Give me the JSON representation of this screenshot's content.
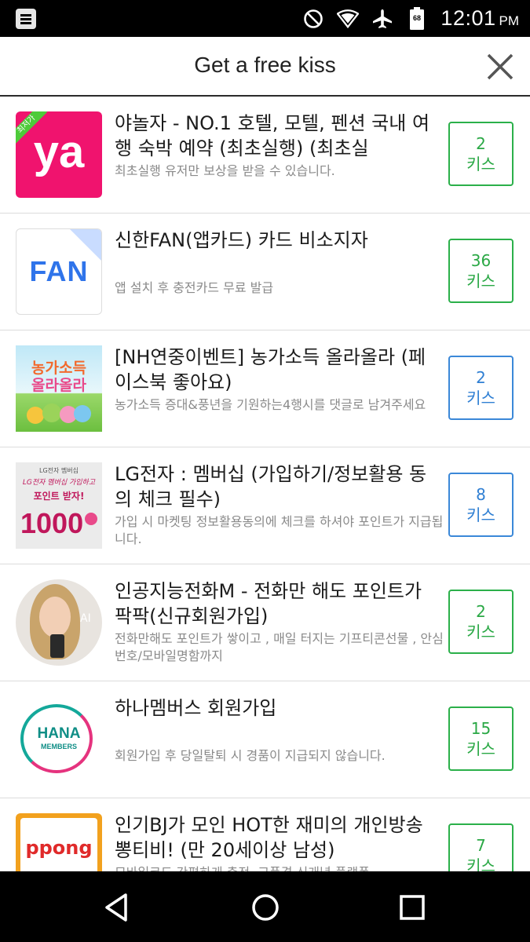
{
  "status_bar": {
    "time": "12:01",
    "ampm": "PM",
    "battery_level": "68",
    "icons": [
      "menu-icon",
      "do-not-disturb-icon",
      "wifi-icon",
      "airplane-mode-icon",
      "battery-icon"
    ]
  },
  "header": {
    "title": "Get a free kiss",
    "close_icon": "close-icon"
  },
  "colors": {
    "green": "#2bb04a",
    "blue": "#3b88d8",
    "ya_pink": "#f0136e"
  },
  "items": [
    {
      "title": "야놀자 - NO.1 호텔, 모텔, 펜션 국내 여행 숙박 예약 (최초실행) (최초실",
      "desc": "최초실행 유저만 보상을 받을 수 있습니다.",
      "kiss_count": "2",
      "kiss_label": "키스",
      "thumb_badge": "최저가",
      "thumb_text": "ya"
    },
    {
      "title": "신한FAN(앱카드) 카드 비소지자",
      "desc": "앱 설치 후 충전카드 무료 발급",
      "kiss_count": "36",
      "kiss_label": "키스",
      "thumb_text": "FAN"
    },
    {
      "title": "[NH연중이벤트] 농가소득 올라올라 (페이스북 좋아요)",
      "desc": "농가소득 증대&풍년을 기원하는4행시를 댓글로 남겨주세요",
      "kiss_count": "2",
      "kiss_label": "키스",
      "thumb_text_1": "농가소득",
      "thumb_text_2": "올라올라"
    },
    {
      "title": "LG전자 : 멤버십 (가입하기/정보활용 동의 체크 필수)",
      "desc": "가입 시 마켓팅 정보활용동의에 체크를 하셔야 포인트가 지급됩니다.",
      "kiss_count": "8",
      "kiss_label": "키스",
      "thumb_text_1": "LG전자 멤버십",
      "thumb_text_2": "LG전자 멤버십 가입하고",
      "thumb_text_3": "포인트 받자!",
      "thumb_text_4": "1000"
    },
    {
      "title": "인공지능전화M - 전화만 해도 포인트가 팍팍(신규회원가입)",
      "desc": "전화만해도 포인트가 쌓이고 , 매일 터지는 기프티콘선물 , 안심번호/모바일명함까지",
      "kiss_count": "2",
      "kiss_label": "키스",
      "thumb_text": "AI"
    },
    {
      "title": "하나멤버스 회원가입",
      "desc": "회원가입 후 당일탈퇴 시 경품이 지급되지 않습니다.",
      "kiss_count": "15",
      "kiss_label": "키스",
      "thumb_text_1": "HANA",
      "thumb_text_2": "MEMBERS"
    },
    {
      "title": "인기BJ가 모인 HOT한 재미의 개인방송 뽕티비! (만 20세이상 남성)",
      "desc": "모바일코드 간편하게 충전, 고품격 신개념 플랫폼",
      "kiss_count": "7",
      "kiss_label": "키스",
      "thumb_text": "ppong"
    }
  ],
  "nav_bar": {
    "icons": [
      "back-icon",
      "home-icon",
      "recents-icon"
    ]
  }
}
